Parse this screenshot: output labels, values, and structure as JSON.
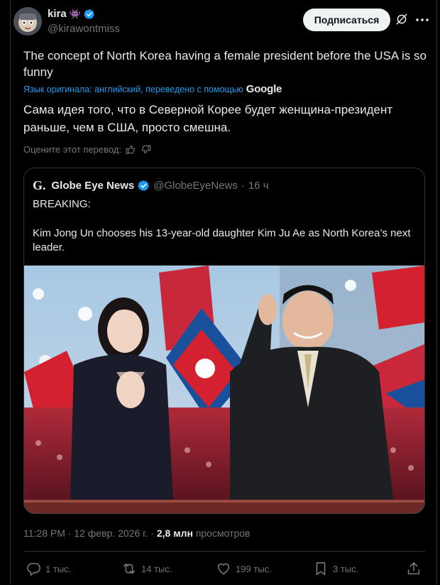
{
  "author": {
    "name": "kira",
    "emoji": "👾",
    "handle": "@kirawontmiss"
  },
  "follow_label": "Подписаться",
  "tweet": {
    "text": "The concept of North Korea having a female president before the USA is so funny",
    "translated_by": "Язык оригинала: английский, переведено с помощью",
    "translator": "Google",
    "translation": "Сама идея того, что в Северной Корее будет женщина-президент раньше, чем в США, просто смешна.",
    "rate_label": "Оцените этот перевод:"
  },
  "quote": {
    "logo": "G.",
    "name": "Globe Eye News",
    "handle": "@GlobeEyeNews",
    "dot": "·",
    "time": "16 ч",
    "line1": "BREAKING:",
    "line2": "Kim Jong Un chooses his 13-year-old daughter Kim Ju Ae as North Korea’s next leader."
  },
  "meta": {
    "time_date": "11:28 PM · 12 февр. 2026 г. ·",
    "views_count": "2,8 млн",
    "views_label": "просмотров"
  },
  "actions": {
    "replies": "1 тыс.",
    "reposts": "14 тыс.",
    "likes": "199 тыс.",
    "bookmarks": "3 тыс."
  },
  "colors": {
    "accent": "#1d9bf0",
    "verified": "#1d9bf0",
    "muted": "#71767b",
    "text": "#e7e9ea",
    "border": "#2f3336"
  }
}
